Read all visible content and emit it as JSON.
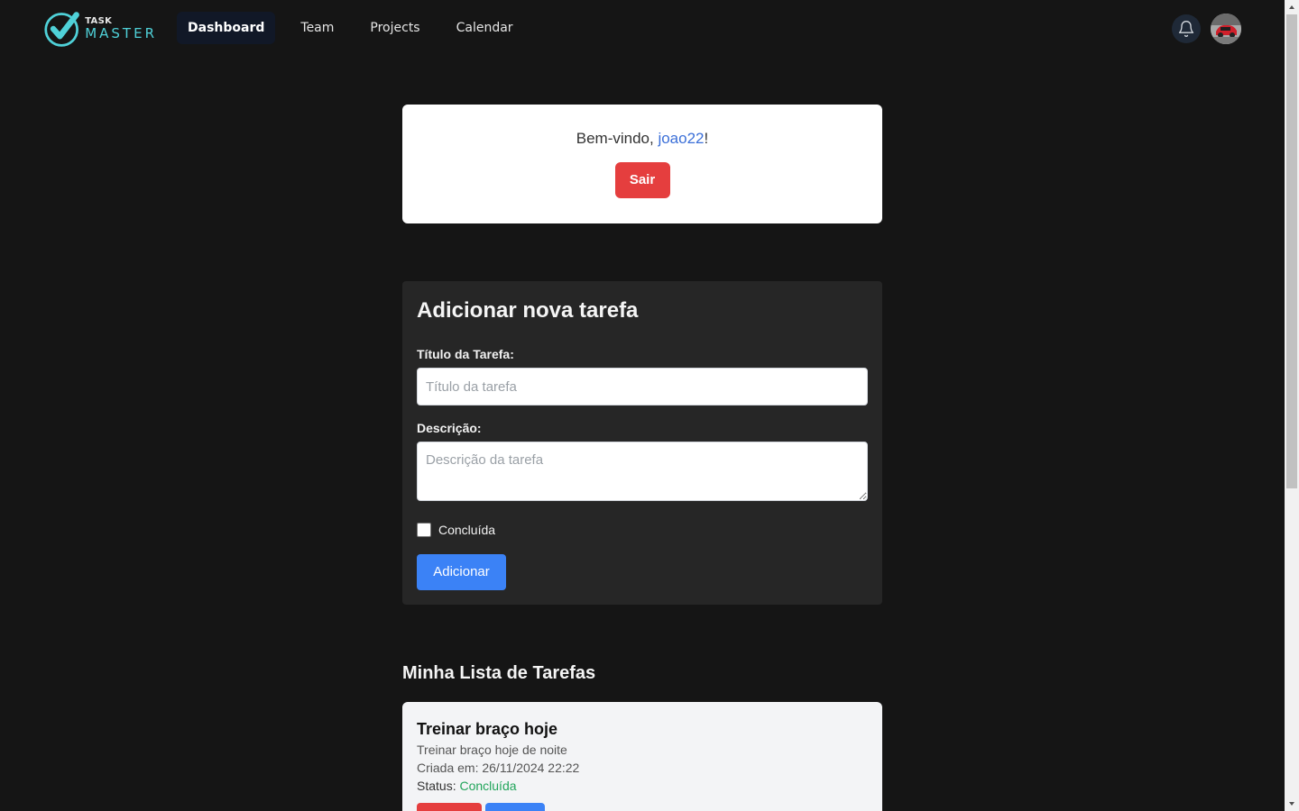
{
  "app": {
    "logo_task": "TASK",
    "logo_master": "MASTER"
  },
  "nav": {
    "items": [
      {
        "label": "Dashboard",
        "active": true
      },
      {
        "label": "Team",
        "active": false
      },
      {
        "label": "Projects",
        "active": false
      },
      {
        "label": "Calendar",
        "active": false
      }
    ],
    "icons": [
      "bell-icon",
      "avatar"
    ]
  },
  "welcome": {
    "greeting": "Bem-vindo, ",
    "username": "joao22",
    "suffix": "!",
    "logout_label": "Sair"
  },
  "form": {
    "title": "Adicionar nova tarefa",
    "title_label": "Título da Tarefa:",
    "title_placeholder": "Título da tarefa",
    "title_value": "",
    "desc_label": "Descrição:",
    "desc_placeholder": "Descrição da tarefa",
    "desc_value": "",
    "done_label": "Concluída",
    "done_checked": false,
    "submit_label": "Adicionar"
  },
  "tasks": {
    "heading": "Minha Lista de Tarefas",
    "items": [
      {
        "title": "Treinar braço hoje",
        "description": "Treinar braço hoje de noite",
        "created": "Criada em: 26/11/2024 22:22",
        "status_label": "Status: ",
        "status": "Concluída"
      }
    ]
  },
  "colors": {
    "background": "#151515",
    "accent_blue": "#3b82f6",
    "danger_red": "#e53e3e",
    "status_green": "#22a55b",
    "logo_teal": "#4fd1d8"
  }
}
